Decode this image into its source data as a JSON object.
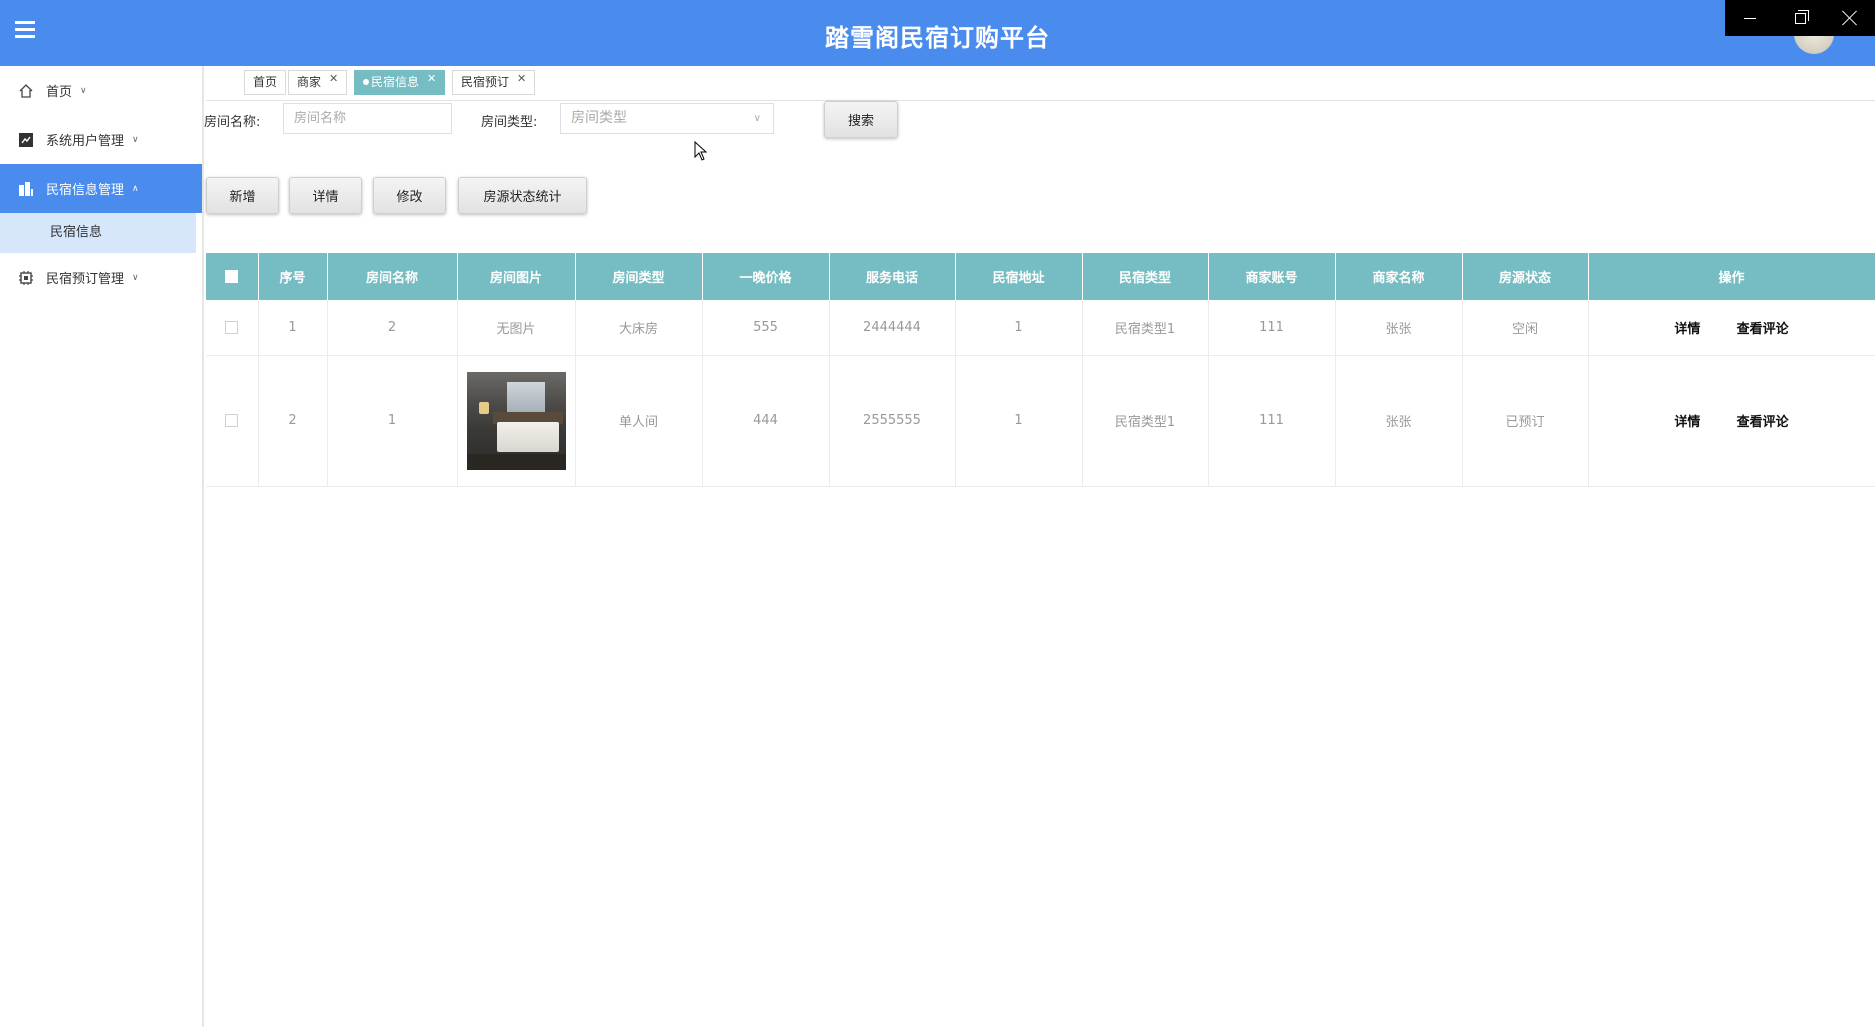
{
  "header": {
    "title": "踏雪阁民宿订购平台"
  },
  "sidebar": {
    "items": [
      {
        "label": "首页",
        "icon": "home-icon"
      },
      {
        "label": "系统用户管理",
        "icon": "chart-icon"
      },
      {
        "label": "民宿信息管理",
        "icon": "building-icon"
      },
      {
        "label": "民宿预订管理",
        "icon": "chip-icon"
      }
    ],
    "sub_items": [
      {
        "label": "民宿信息"
      }
    ]
  },
  "tabs": [
    {
      "label": "首页"
    },
    {
      "label": "商家"
    },
    {
      "label": "民宿信息"
    },
    {
      "label": "民宿预订"
    }
  ],
  "search": {
    "room_name_label": "房间名称:",
    "room_name_placeholder": "房间名称",
    "room_type_label": "房间类型:",
    "room_type_placeholder": "房间类型",
    "search_button": "搜索"
  },
  "actions": {
    "add": "新增",
    "detail": "详情",
    "edit": "修改",
    "stats": "房源状态统计"
  },
  "table": {
    "columns": [
      "序号",
      "房间名称",
      "房间图片",
      "房间类型",
      "一晚价格",
      "服务电话",
      "民宿地址",
      "民宿类型",
      "商家账号",
      "商家名称",
      "房源状态",
      "操作"
    ],
    "rows": [
      {
        "index": "1",
        "room_name": "2",
        "image": "无图片",
        "room_type": "大床房",
        "price": "555",
        "phone": "2444444",
        "address": "1",
        "homestay_type": "民宿类型1",
        "merchant_account": "111",
        "merchant_name": "张张",
        "status": "空闲",
        "op_detail": "详情",
        "op_comments": "查看评论"
      },
      {
        "index": "2",
        "room_name": "1",
        "image": "",
        "room_type": "单人间",
        "price": "444",
        "phone": "2555555",
        "address": "1",
        "homestay_type": "民宿类型1",
        "merchant_account": "111",
        "merchant_name": "张张",
        "status": "已预订",
        "op_detail": "详情",
        "op_comments": "查看评论"
      }
    ]
  }
}
